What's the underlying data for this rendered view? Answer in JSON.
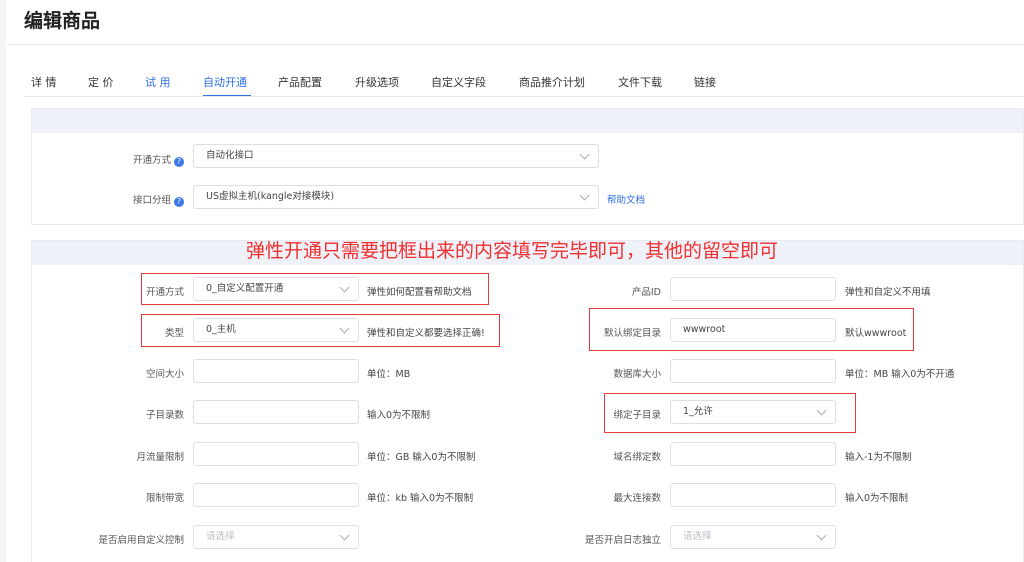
{
  "page_title": "编辑商品",
  "tabs": [
    "详 情",
    "定 价",
    "试 用",
    "自动开通",
    "产品配置",
    "升级选项",
    "自定义字段",
    "商品推介计划",
    "文件下载",
    "链接"
  ],
  "top_form": {
    "open_method_label": "开通方式",
    "open_method_value": "自动化接口",
    "api_group_label": "接口分组",
    "api_group_value": "US虚拟主机(kangle对接模块)",
    "help_doc_link": "帮助文档"
  },
  "banner": "弹性开通只需要把框出来的内容填写完毕即可，其他的留空即可",
  "left_fields": {
    "open_method": {
      "label": "开通方式",
      "value": "0_自定义配置开通",
      "hint": "弹性如何配置看帮助文档"
    },
    "type": {
      "label": "类型",
      "value": "0_主机",
      "hint": "弹性和自定义都要选择正确!"
    },
    "space": {
      "label": "空间大小",
      "value": "",
      "hint": "单位：MB"
    },
    "subdirs": {
      "label": "子目录数",
      "value": "",
      "hint": "输入0为不限制"
    },
    "traffic": {
      "label": "月流量限制",
      "value": "",
      "hint": "单位：GB 输入0为不限制"
    },
    "bandwidth": {
      "label": "限制带宽",
      "value": "",
      "hint": "单位：kb 输入0为不限制"
    },
    "custom_ctrl": {
      "label": "是否启用自定义控制",
      "placeholder": "请选择"
    }
  },
  "right_fields": {
    "product_id": {
      "label": "产品ID",
      "value": "",
      "hint": "弹性和自定义不用填"
    },
    "default_dir": {
      "label": "默认绑定目录",
      "value": "wwwroot",
      "hint": "默认wwwroot"
    },
    "db_size": {
      "label": "数据库大小",
      "value": "",
      "hint": "单位：MB 输入0为不开通"
    },
    "bind_subdir": {
      "label": "绑定子目录",
      "value": "1_允许"
    },
    "domain_count": {
      "label": "域名绑定数",
      "value": "",
      "hint": "输入-1为不限制"
    },
    "max_conn": {
      "label": "最大连接数",
      "value": "",
      "hint": "输入0为不限制"
    },
    "log_independent": {
      "label": "是否开启日志独立",
      "placeholder": "请选择"
    }
  },
  "colors": {
    "accent": "#2f6fe4",
    "annotation": "#e23b3b",
    "banner_text": "#f0302f"
  }
}
